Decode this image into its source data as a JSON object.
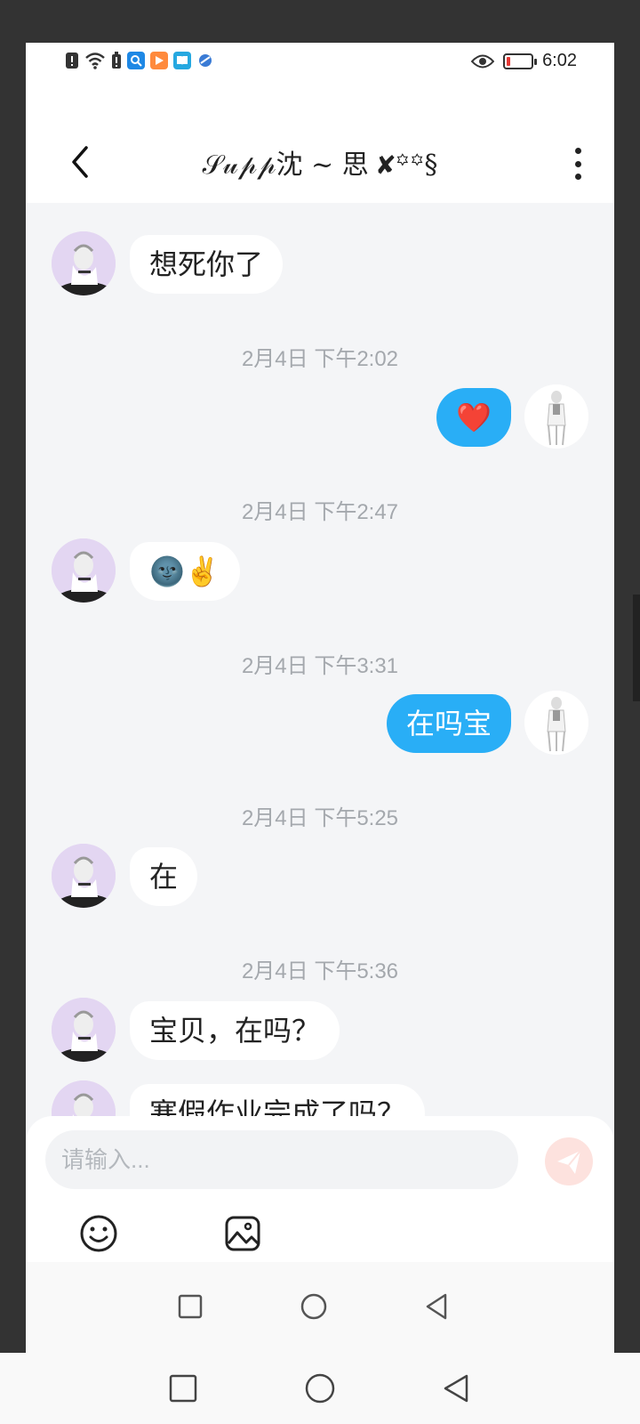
{
  "status_bar": {
    "time": "6:02",
    "left_icons": [
      "alert-icon",
      "wifi-icon",
      "battery-alert-icon",
      "app-search-icon",
      "app-play-icon",
      "app-book-icon",
      "app-browser-icon"
    ],
    "right_icons": [
      "eye-icon",
      "battery-icon"
    ]
  },
  "header": {
    "title": "𝒮𝓊𝓅𝓅沈 ~ 思 ✘꙳꙳§",
    "back_icon": "chevron-left-icon",
    "menu_icon": "more-vertical-icon"
  },
  "messages": [
    {
      "type": "in",
      "text": "想死你了"
    },
    {
      "type": "timestamp",
      "text": "2月4日 下午2:02"
    },
    {
      "type": "out",
      "text": "❤️"
    },
    {
      "type": "timestamp",
      "text": "2月4日 下午2:47"
    },
    {
      "type": "in",
      "text": "🌚✌️"
    },
    {
      "type": "timestamp",
      "text": "2月4日 下午3:31"
    },
    {
      "type": "out",
      "text": "在吗宝"
    },
    {
      "type": "timestamp",
      "text": "2月4日 下午5:25"
    },
    {
      "type": "in",
      "text": "在"
    },
    {
      "type": "timestamp",
      "text": "2月4日 下午5:36"
    },
    {
      "type": "in",
      "text": "宝贝，在吗？"
    },
    {
      "type": "in",
      "text": "寒假作业完成了吗？"
    }
  ],
  "composer": {
    "placeholder": "请输入...",
    "send_icon": "send-icon",
    "emoji_icon": "emoji-icon",
    "image_icon": "image-icon"
  },
  "colors": {
    "outgoing_bubble": "#29aef6",
    "incoming_bubble": "#ffffff",
    "chat_background": "#f4f5f7",
    "send_button": "#fde2de"
  }
}
